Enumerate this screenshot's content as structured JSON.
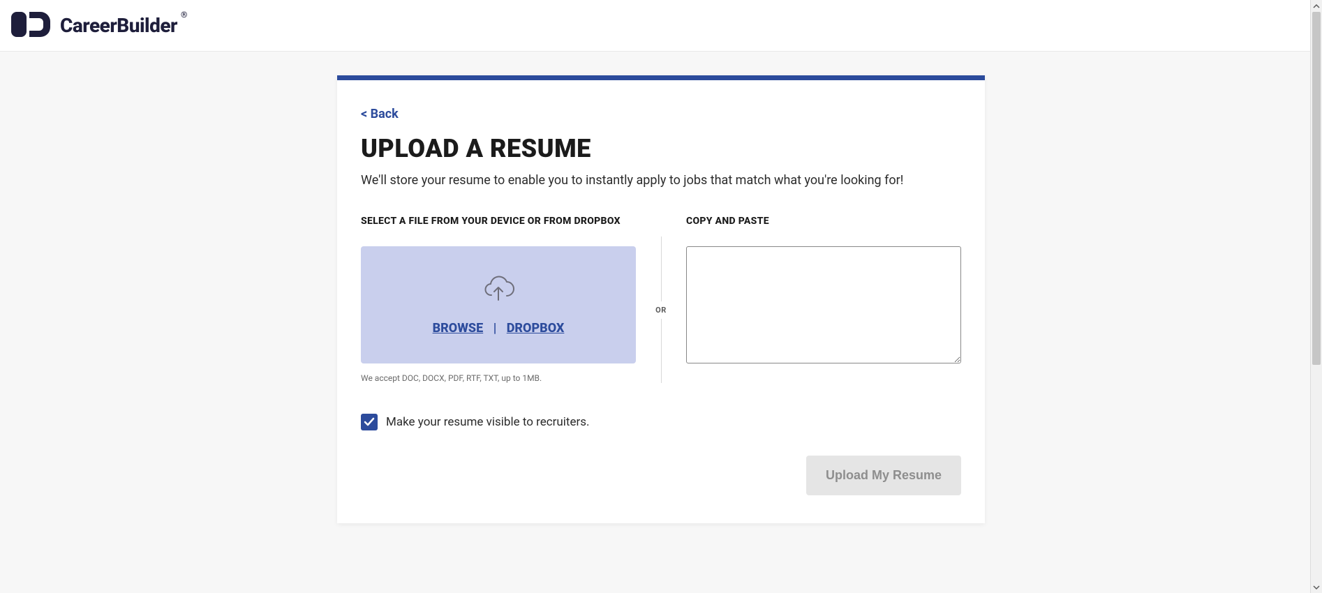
{
  "brand": {
    "name": "CareerBuilder",
    "registered_symbol": "®"
  },
  "nav": {
    "back_label": "< Back"
  },
  "page": {
    "title": "UPLOAD A RESUME",
    "description": "We'll store your resume to enable you to instantly apply to jobs that match what you're looking for!"
  },
  "upload": {
    "select_label": "SELECT A FILE FROM YOUR DEVICE OR FROM DROPBOX",
    "browse_label": "BROWSE",
    "link_divider": "|",
    "dropbox_label": "DROPBOX",
    "file_hint": "We accept DOC, DOCX, PDF, RTF, TXT, up to 1MB."
  },
  "separator": {
    "or_label": "OR"
  },
  "paste": {
    "label": "COPY AND PASTE",
    "value": ""
  },
  "visibility": {
    "checked": true,
    "label": "Make your resume visible to recruiters."
  },
  "actions": {
    "submit_label": "Upload My Resume"
  },
  "colors": {
    "accent": "#2c4b9c",
    "dropzone_bg": "#c9cfed",
    "disabled_bg": "#e5e5e5",
    "disabled_fg": "#8e8e8e"
  }
}
